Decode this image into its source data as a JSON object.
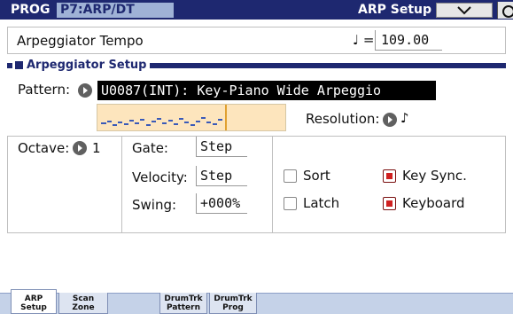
{
  "header": {
    "mode": "PROG",
    "program": "P7:ARP/DT",
    "page": "ARP Setup",
    "menu_icon": "chevron-down-icon"
  },
  "tempo": {
    "label": "Arpeggiator Tempo",
    "note_symbol": "♩ =",
    "value": "109.00"
  },
  "section": {
    "title": "Arpeggiator Setup"
  },
  "pattern": {
    "label": "Pattern:",
    "value": "U0087(INT): Key-Piano Wide Arpeggio"
  },
  "resolution": {
    "label": "Resolution:",
    "value": "♪"
  },
  "octave": {
    "label": "Octave:",
    "value": "1"
  },
  "fields": {
    "gate": {
      "label": "Gate:",
      "value": "Step"
    },
    "velocity": {
      "label": "Velocity:",
      "value": "Step"
    },
    "swing": {
      "label": "Swing:",
      "value": "+000%"
    }
  },
  "checkboxes": {
    "sort": {
      "label": "Sort",
      "checked": false
    },
    "key_sync": {
      "label": "Key Sync.",
      "checked": true
    },
    "latch": {
      "label": "Latch",
      "checked": false
    },
    "keyboard": {
      "label": "Keyboard",
      "checked": true
    }
  },
  "tabs": [
    {
      "line1": "ARP",
      "line2": "Setup",
      "active": true
    },
    {
      "line1": "Scan",
      "line2": "Zone",
      "active": false
    },
    {
      "line1": "DrumTrk",
      "line2": "Pattern",
      "active": false
    },
    {
      "line1": "DrumTrk",
      "line2": "Prog",
      "active": false
    }
  ],
  "colors": {
    "header_bg": "#1e2870",
    "program_field_bg": "#9fb2d6",
    "pattern_preview_bg": "#fde5bd",
    "checkbox_on": "#d02020",
    "tab_strip_bg": "#c5d2e8"
  }
}
